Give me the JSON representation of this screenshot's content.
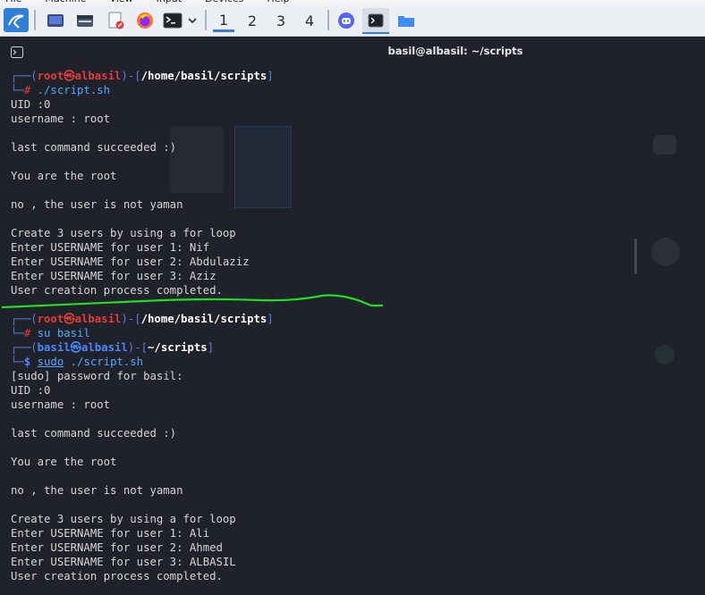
{
  "host_menu": [
    "File",
    "Machine",
    "View",
    "Input",
    "Devices",
    "Help"
  ],
  "panel": {
    "workspaces": [
      "1",
      "2",
      "3",
      "4"
    ],
    "active_workspace": "1",
    "icons": [
      "kali-menu-icon",
      "desktop-icon",
      "file-manager-icon",
      "text-editor-icon",
      "firefox-icon",
      "terminal-icon",
      "discord-icon",
      "terminal-icon",
      "folder-icon"
    ]
  },
  "terminal": {
    "title": "basil@albasil: ~/scripts",
    "lines": [
      {
        "kind": "prompt-root",
        "user": "root",
        "host": "albasil",
        "path": "/home/basil/scripts"
      },
      {
        "kind": "cmd-root",
        "sym": "#",
        "text": "./script.sh"
      },
      {
        "kind": "out",
        "text": "UID :0"
      },
      {
        "kind": "out",
        "text": "username : root"
      },
      {
        "kind": "out",
        "text": ""
      },
      {
        "kind": "out",
        "text": "last command succeeded :)"
      },
      {
        "kind": "out",
        "text": ""
      },
      {
        "kind": "out",
        "text": "You are the root"
      },
      {
        "kind": "out",
        "text": ""
      },
      {
        "kind": "out",
        "text": "no , the user is not yaman"
      },
      {
        "kind": "out",
        "text": ""
      },
      {
        "kind": "out",
        "text": "Create 3 users by using a for loop"
      },
      {
        "kind": "out",
        "text": "Enter USERNAME for user 1: Nif"
      },
      {
        "kind": "out",
        "text": "Enter USERNAME for user 2: Abdulaziz"
      },
      {
        "kind": "out",
        "text": "Enter USERNAME for user 3: Aziz"
      },
      {
        "kind": "out",
        "text": "User creation process completed."
      },
      {
        "kind": "blank-sep",
        "text": ""
      },
      {
        "kind": "prompt-root",
        "user": "root",
        "host": "albasil",
        "path": "/home/basil/scripts"
      },
      {
        "kind": "cmd-root",
        "sym": "#",
        "text": "su basil"
      },
      {
        "kind": "prompt-user",
        "user": "basil",
        "host": "albasil",
        "path": "~/scripts"
      },
      {
        "kind": "cmd-user",
        "sym": "$",
        "cmd": "sudo",
        "text": " ./script.sh"
      },
      {
        "kind": "out",
        "text": "[sudo] password for basil:"
      },
      {
        "kind": "out",
        "text": "UID :0"
      },
      {
        "kind": "out",
        "text": "username : root"
      },
      {
        "kind": "out",
        "text": ""
      },
      {
        "kind": "out",
        "text": "last command succeeded :)"
      },
      {
        "kind": "out",
        "text": ""
      },
      {
        "kind": "out",
        "text": "You are the root"
      },
      {
        "kind": "out",
        "text": ""
      },
      {
        "kind": "out",
        "text": "no , the user is not yaman"
      },
      {
        "kind": "out",
        "text": ""
      },
      {
        "kind": "out",
        "text": "Create 3 users by using a for loop"
      },
      {
        "kind": "out",
        "text": "Enter USERNAME for user 1: Ali"
      },
      {
        "kind": "out",
        "text": "Enter USERNAME for user 2: Ahmed"
      },
      {
        "kind": "out",
        "text": "Enter USERNAME for user 3: ALBASIL"
      },
      {
        "kind": "out",
        "text": "User creation process completed."
      }
    ]
  },
  "annotation": {
    "color": "#22dd22"
  },
  "colors": {
    "bg": "#1f222b",
    "prompt_line": "#5b7dd8",
    "root": "#e33b3b",
    "user": "#4b88ff"
  }
}
